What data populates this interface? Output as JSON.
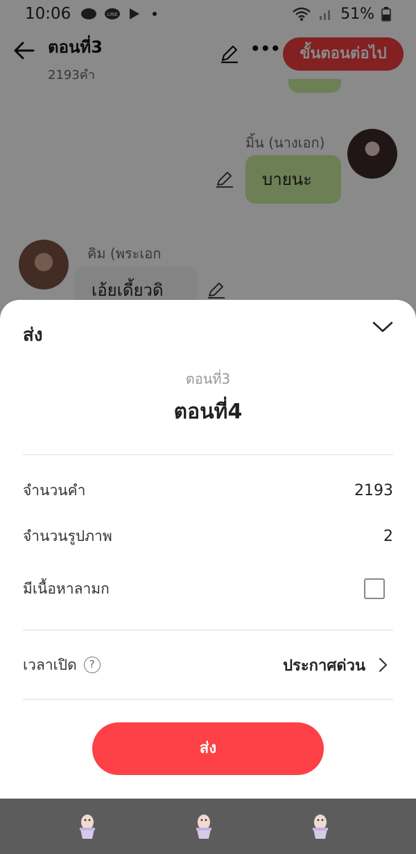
{
  "status_bar": {
    "time": "10:06",
    "battery": "51%"
  },
  "app_bar": {
    "title": "ตอนที่3",
    "word_count": "2193คำ",
    "next_step_label": "ขั้นตอนต่อไป"
  },
  "chat": {
    "messages": [
      {
        "speaker": "มิ้น (นางเอก)",
        "text": "บายนะ",
        "side": "right"
      },
      {
        "speaker": "คิม (พระเอก",
        "text": "เอ้ยเดี้ยวดิ",
        "side": "left"
      }
    ]
  },
  "sheet": {
    "title": "ส่ง",
    "from_episode": "ตอนที่3",
    "to_episode": "ตอนที่4",
    "rows": {
      "word_count_label": "จำนวนคำ",
      "word_count_value": "2193",
      "image_count_label": "จำนวนรูปภาพ",
      "image_count_value": "2",
      "mature_label": "มีเนื้อหาลามก",
      "mature_checked": false,
      "publish_time_label": "เวลาเปิด",
      "publish_time_value": "ประกาศด่วน"
    },
    "send_label": "ส่ง"
  },
  "colors": {
    "accent": "#fd4146",
    "header_button": "#f23b40",
    "bubble_right": "#c9ea9d",
    "bubble_left": "#f4f4f4"
  },
  "icons": {
    "back": "arrow-left-icon",
    "edit": "pencil-icon",
    "more": "more-horizontal-icon",
    "close": "chevron-down-icon",
    "help": "question-circle-icon",
    "chevron": "chevron-right-icon",
    "nav": "cactus-pot-icon"
  }
}
